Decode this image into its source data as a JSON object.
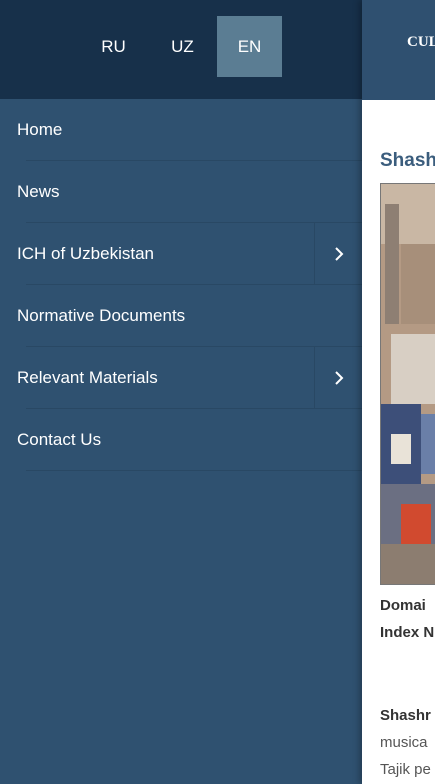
{
  "languages": [
    {
      "code": "RU",
      "active": false
    },
    {
      "code": "UZ",
      "active": false
    },
    {
      "code": "EN",
      "active": true
    }
  ],
  "menu": {
    "items": [
      {
        "label": "Home",
        "has_submenu": false
      },
      {
        "label": "News",
        "has_submenu": false
      },
      {
        "label": "ICH of Uzbekistan",
        "has_submenu": true
      },
      {
        "label": "Normative Documents",
        "has_submenu": false
      },
      {
        "label": "Relevant Materials",
        "has_submenu": true
      },
      {
        "label": "Contact Us",
        "has_submenu": false
      }
    ],
    "submenu_icon": "chevron-right-icon"
  },
  "page": {
    "site_title": "CUL",
    "article_title": "Shash",
    "meta_domain": "Domai",
    "meta_index": "Index N",
    "body_line_1": "Shashr",
    "body_line_2": "musica",
    "body_line_3": "Tajik pe"
  },
  "colors": {
    "lang_bar": "#17304a",
    "drawer": "#2f5170",
    "active_lang": "#5b7d93",
    "article_title": "#3b5d7d"
  }
}
